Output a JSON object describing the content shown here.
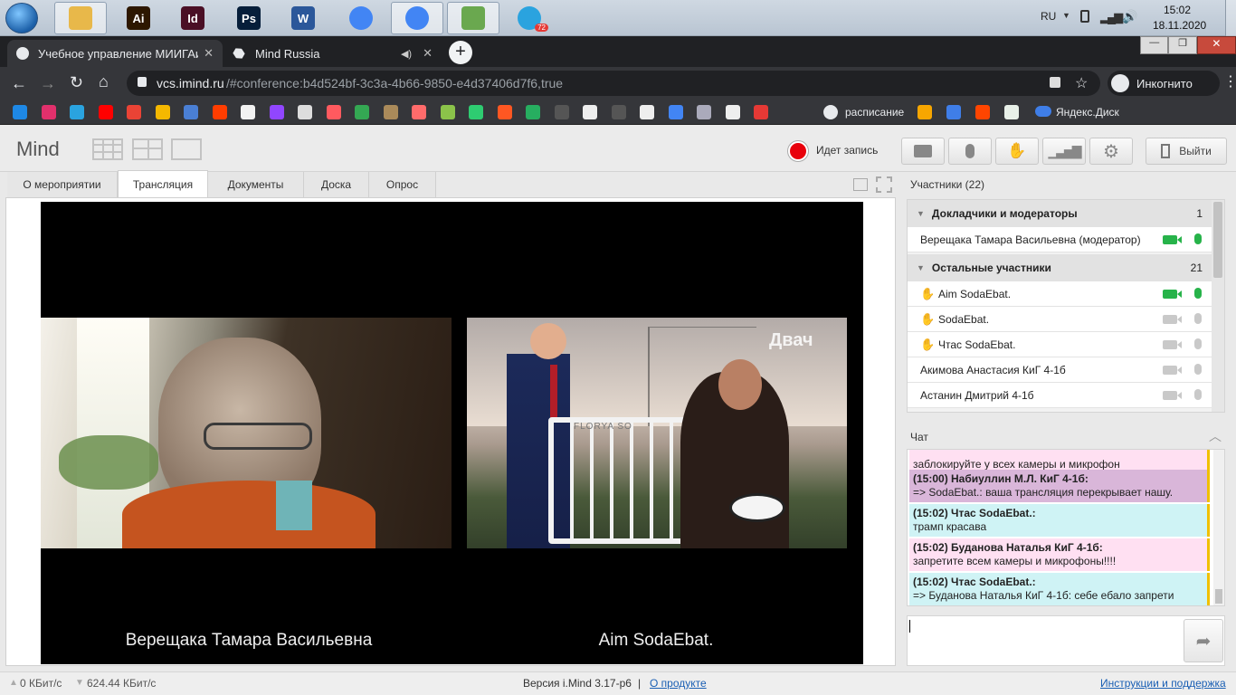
{
  "taskbar": {
    "language": "RU",
    "time": "15:02",
    "date": "18.11.2020",
    "telegram_badge": "72",
    "apps": [
      {
        "name": "explorer",
        "label": "",
        "color": "#e8b84a"
      },
      {
        "name": "illustrator",
        "label": "Ai",
        "color": "#2d1700"
      },
      {
        "name": "indesign",
        "label": "Id",
        "color": "#4a0f25"
      },
      {
        "name": "photoshop",
        "label": "Ps",
        "color": "#061e3a"
      },
      {
        "name": "word",
        "label": "W",
        "color": "#2b579a"
      },
      {
        "name": "chrome",
        "label": "",
        "color": "#4285f4"
      },
      {
        "name": "chrome-incognito",
        "label": "",
        "color": "#4285f4"
      },
      {
        "name": "notepad",
        "label": "",
        "color": "#6aa84f"
      },
      {
        "name": "telegram",
        "label": "",
        "color": "#2aa3df"
      }
    ]
  },
  "browser": {
    "tabs": [
      {
        "title": "Учебное управление МИИГАиК",
        "active": true
      },
      {
        "title": "Mind Russia",
        "active": false
      }
    ],
    "url_host": "vcs.imind.ru",
    "url_rest": "/#conference:b4d524bf-3c3a-4b66-9850-e4d37406d7f6,true",
    "incognito_label": "Инкогнито",
    "bookmarks_text": [
      {
        "label": "расписание"
      },
      {
        "label": "Яндекс.Диск"
      }
    ]
  },
  "app": {
    "logo": "Mind",
    "recording_label": "Идет запись",
    "exit_label": "Выйти",
    "tabs": [
      "О мероприятии",
      "Трансляция",
      "Документы",
      "Доска",
      "Опрос"
    ],
    "active_tab": 1,
    "video": {
      "left_name": "Верещака Тамара Васильевна",
      "right_name": "Aim SodaEbat.",
      "watermark": "Двач",
      "bench_text": "FLORYA SO"
    },
    "participants": {
      "title": "Участники (22)",
      "groups": [
        {
          "name": "Докладчики и модераторы",
          "count": "1"
        },
        {
          "name": "Остальные участники",
          "count": "21"
        }
      ],
      "moderators": [
        {
          "name": "Верещака Тамара Васильевна (модератор)",
          "cam": "active",
          "mic": "active"
        }
      ],
      "others": [
        {
          "name": "Aim SodaEbat.",
          "hand": true,
          "cam": "active",
          "mic": "active"
        },
        {
          "name": "SodaEbat.",
          "hand": true,
          "cam": "off",
          "mic": "off"
        },
        {
          "name": "Чтас SodaEbat.",
          "hand": true,
          "cam": "off",
          "mic": "off"
        },
        {
          "name": "Акимова Анастасия КиГ 4-1б",
          "hand": false,
          "cam": "off",
          "mic": "off"
        },
        {
          "name": "Астанин Дмитрий 4-1б",
          "hand": false,
          "cam": "off",
          "mic": "off"
        }
      ]
    },
    "chat": {
      "title": "Чат",
      "messages": [
        {
          "author": "",
          "text": "заблокируйте у всех камеры и микрофон",
          "bg": "#ffe0f2"
        },
        {
          "author": "(15:00) Набиуллин М.Л. КиГ 4-1б:",
          "text": "=> SodaEbat.: ваша трансляция перекрывает нашу.",
          "bg": "#d9b6d9"
        },
        {
          "author": "(15:02) Чтас SodaEbat.:",
          "text": "трамп красава",
          "bg": "#cff3f5"
        },
        {
          "author": "(15:02) Буданова Наталья КиГ 4-1б:",
          "text": "запретите всем камеры и микрофоны!!!!",
          "bg": "#ffe0f2"
        },
        {
          "author": "(15:02) Чтас SodaEbat.:",
          "text": "=> Буданова Наталья КиГ 4-1б: себе ебало запрети",
          "bg": "#cff3f5"
        }
      ],
      "input_value": ""
    },
    "footer": {
      "upload": "0 КБит/с",
      "download": "624.44 КБит/с",
      "version": "Версия i.Mind 3.17-p6",
      "separator": "|",
      "about_link": "О продукте",
      "help_link": "Инструкции и поддержка"
    }
  },
  "colors": {
    "cam_active": "#27b34a",
    "mic_active": "#27b34a",
    "icon_off": "#c9c9c9",
    "record": "#e8000b",
    "link": "#1a5fb4"
  }
}
